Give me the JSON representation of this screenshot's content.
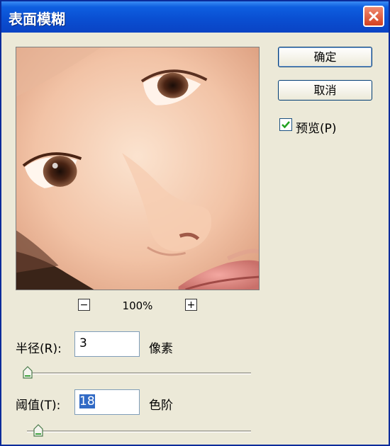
{
  "window": {
    "title": "表面模糊"
  },
  "buttons": {
    "ok": "确定",
    "cancel": "取消"
  },
  "preview": {
    "label": "预览(P)",
    "checked": true
  },
  "zoom": {
    "minus": "−",
    "level": "100%",
    "plus": "+"
  },
  "radius": {
    "label": "半径(R):",
    "value": "3",
    "unit": "像素",
    "level": 0.0
  },
  "threshold": {
    "label": "阈值(T):",
    "value": "18",
    "unit": "色阶",
    "level": 0.05
  }
}
